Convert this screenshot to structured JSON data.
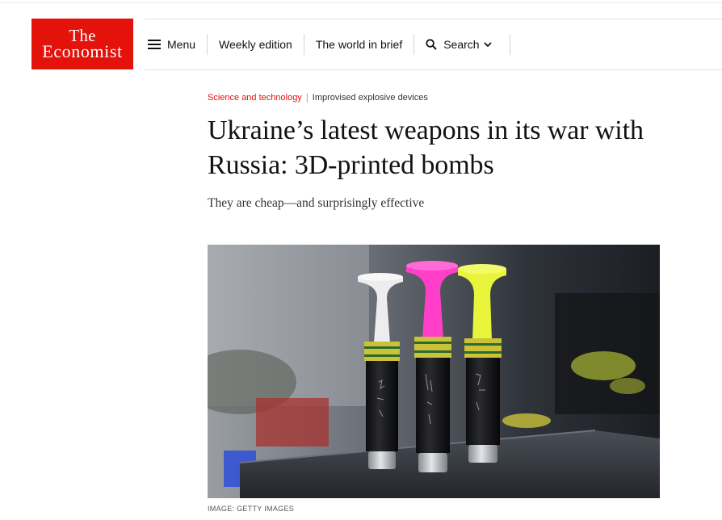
{
  "brand": {
    "logo_line1": "The",
    "logo_line2": "Economist",
    "color": "#e3120b"
  },
  "nav": {
    "menu_label": "Menu",
    "weekly_label": "Weekly edition",
    "brief_label": "The world in brief",
    "search_label": "Search"
  },
  "article": {
    "section": "Science and technology",
    "separator": "|",
    "topic": "Improvised explosive devices",
    "headline": "Ukraine’s latest weapons in its war with Russia: 3D-printed bombs",
    "rubric": "They are cheap—and surprisingly effective"
  },
  "image": {
    "credit": "Image: Getty Images",
    "icon": "photo-3d-printed-bombs",
    "colors": {
      "white_fin": "#eeeeee",
      "pink_fin": "#ff3fc8",
      "yellow_fin": "#e9f53a",
      "band": "#c9c23a"
    }
  }
}
